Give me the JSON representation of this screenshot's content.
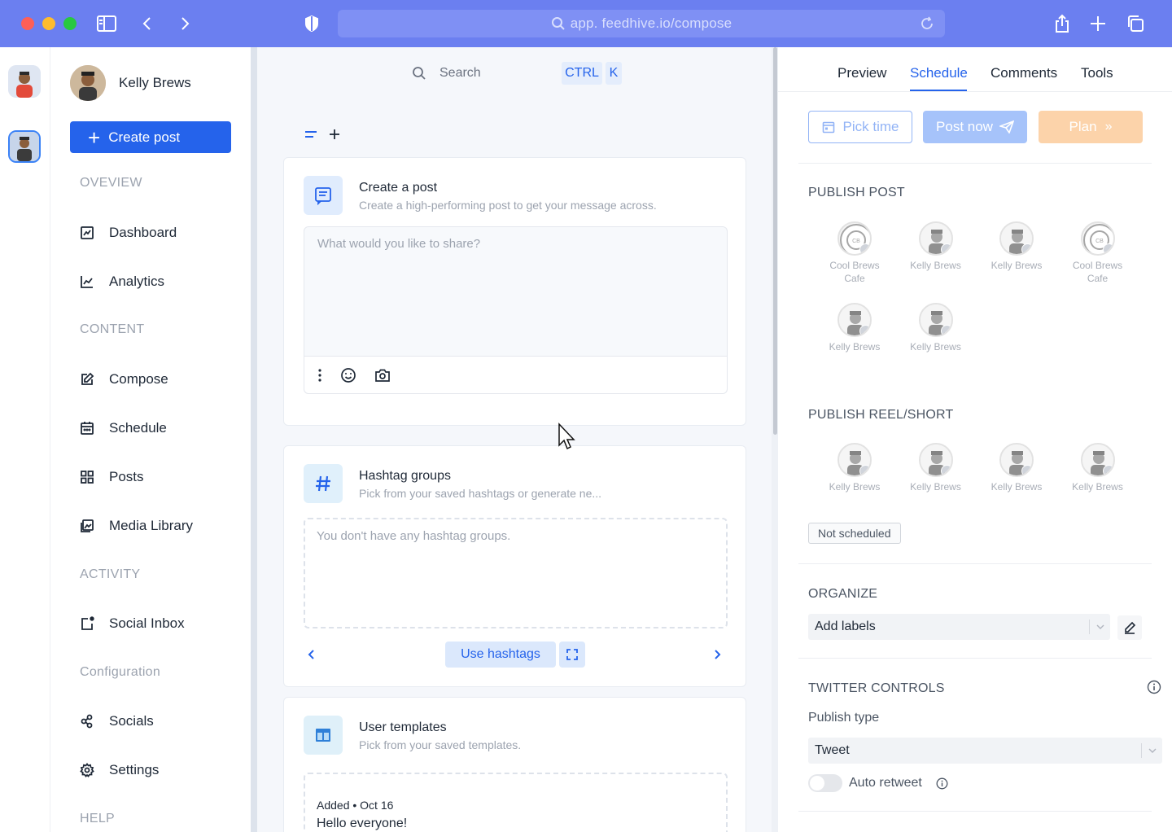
{
  "browser": {
    "url": "app. feedhive.io/compose"
  },
  "sidebar": {
    "profile_name": "Kelly Brews",
    "create_label": "Create post",
    "sections": {
      "overview": "OVEVIEW",
      "content": "CONTENT",
      "activity": "ACTIVITY",
      "configuration": "Configuration",
      "help": "HELP"
    },
    "items": {
      "dashboard": "Dashboard",
      "analytics": "Analytics",
      "compose": "Compose",
      "schedule": "Schedule",
      "posts": "Posts",
      "media": "Media Library",
      "inbox": "Social Inbox",
      "socials": "Socials",
      "settings": "Settings"
    }
  },
  "compose": {
    "search_placeholder": "Search",
    "kbd_ctrl": "CTRL",
    "kbd_k": "K",
    "create_card": {
      "title": "Create a post",
      "subtitle": "Create a high-performing post to get your message across.",
      "placeholder": "What would you like to share?"
    },
    "hashtag_card": {
      "title": "Hashtag groups",
      "subtitle": "Pick from your saved hashtags or generate ne...",
      "empty": "You don't have any hashtag groups.",
      "use_label": "Use hashtags"
    },
    "templates_card": {
      "title": "User templates",
      "subtitle": "Pick from your saved templates.",
      "added": "Added • Oct 16",
      "preview": "Hello everyone!"
    }
  },
  "panel": {
    "tabs": [
      "Preview",
      "Schedule",
      "Comments",
      "Tools"
    ],
    "pick_time": "Pick time",
    "post_now": "Post now",
    "plan": "Plan",
    "publish_post_label": "PUBLISH POST",
    "publish_post_accounts": [
      {
        "name": "Cool Brews Cafe",
        "line1": "Cool Brews",
        "line2": "Cafe",
        "network": "generic"
      },
      {
        "name": "Kelly Brews",
        "line1": "Kelly Brews",
        "line2": "",
        "network": "instagram"
      },
      {
        "name": "Kelly Brews",
        "line1": "Kelly Brews",
        "line2": "",
        "network": "facebook"
      },
      {
        "name": "Cool Brews Cafe",
        "line1": "Cool Brews",
        "line2": "Cafe",
        "network": "linkedin"
      },
      {
        "name": "Kelly Brews",
        "line1": "Kelly Brews",
        "line2": "",
        "network": "twitter"
      },
      {
        "name": "Kelly Brews",
        "line1": "Kelly Brews",
        "line2": "",
        "network": "pinterest"
      }
    ],
    "publish_reel_label": "PUBLISH REEL/SHORT",
    "publish_reel_accounts": [
      {
        "line1": "Kelly Brews",
        "network": "instagram"
      },
      {
        "line1": "Kelly Brews",
        "network": "facebook"
      },
      {
        "line1": "Kelly Brews",
        "network": "youtube"
      },
      {
        "line1": "Kelly Brews",
        "network": "tiktok"
      }
    ],
    "status": "Not scheduled",
    "organize_label": "ORGANIZE",
    "labels_value": "Add labels",
    "twitter_label": "TWITTER CONTROLS",
    "publish_type_label": "Publish type",
    "publish_type_value": "Tweet",
    "auto_retweet": "Auto retweet"
  },
  "colors": {
    "brand": "#6b7ff0",
    "primary": "#2563eb",
    "plan": "#fcd3aa"
  }
}
